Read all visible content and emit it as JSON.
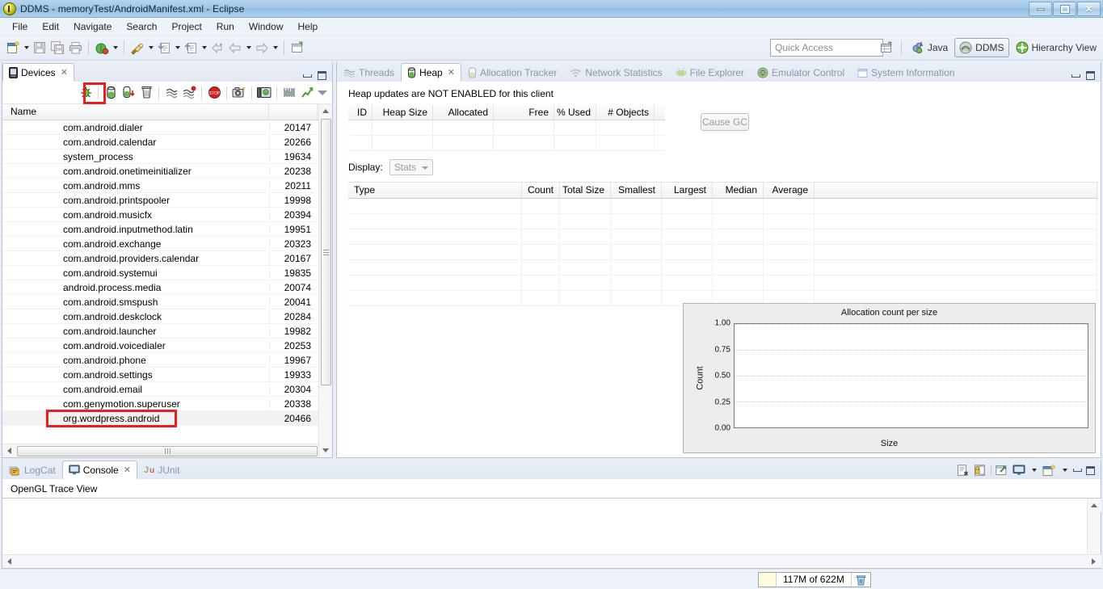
{
  "window": {
    "title": "DDMS - memoryTest/AndroidManifest.xml - Eclipse",
    "app_icon": "eclipse-icon",
    "minimize": "minimize-icon",
    "maximize": "restore-icon",
    "close": "close-icon"
  },
  "menu": {
    "items": [
      "File",
      "Edit",
      "Navigate",
      "Search",
      "Project",
      "Run",
      "Window",
      "Help"
    ]
  },
  "toolbar": {
    "icons": [
      "new-wizard-icon",
      "save-icon",
      "save-all-icon",
      "print-icon",
      "debug-icon",
      "run-icon",
      "external-tools-icon",
      "new-java-class-icon",
      "open-type-icon",
      "back-icon",
      "previous-icon",
      "forward-icon",
      "open-perspective-icon"
    ],
    "quick_access": {
      "placeholder": "Quick Access",
      "value": ""
    },
    "open_perspective_icon": "open-perspective-icon",
    "perspectives": [
      {
        "label": "Java",
        "icon": "java-perspective-icon",
        "active": false
      },
      {
        "label": "DDMS",
        "icon": "ddms-perspective-icon",
        "active": true
      },
      {
        "label": "Hierarchy View",
        "icon": "hierarchy-view-perspective-icon",
        "active": false
      }
    ]
  },
  "devices_view": {
    "tab_label": "Devices",
    "tab_icon": "device-icon",
    "tab_close": "close-icon",
    "minimize": "minimize-icon",
    "maximize": "maximize-icon",
    "toolbar_icons": [
      "debug-process-icon",
      "update-heap-icon",
      "dump-hprof-icon",
      "cause-gc-icon",
      "update-threads-icon",
      "start-method-profiling-icon",
      "stop-process-icon",
      "screen-capture-icon",
      "device-screenshot-icon",
      "systrace-icon",
      "opengl-trace-icon"
    ],
    "highlighted_toolbar_icon": "update-heap-icon",
    "view_menu_icon": "view-menu-icon",
    "columns": [
      "Name",
      ""
    ],
    "rows": [
      {
        "name": "com.android.dialer",
        "pid": "20147"
      },
      {
        "name": "com.android.calendar",
        "pid": "20266"
      },
      {
        "name": "system_process",
        "pid": "19634"
      },
      {
        "name": "com.android.onetimeinitializer",
        "pid": "20238"
      },
      {
        "name": "com.android.mms",
        "pid": "20211"
      },
      {
        "name": "com.android.printspooler",
        "pid": "19998"
      },
      {
        "name": "com.android.musicfx",
        "pid": "20394"
      },
      {
        "name": "com.android.inputmethod.latin",
        "pid": "19951"
      },
      {
        "name": "com.android.exchange",
        "pid": "20323"
      },
      {
        "name": "com.android.providers.calendar",
        "pid": "20167"
      },
      {
        "name": "com.android.systemui",
        "pid": "19835"
      },
      {
        "name": "android.process.media",
        "pid": "20074"
      },
      {
        "name": "com.android.smspush",
        "pid": "20041"
      },
      {
        "name": "com.android.deskclock",
        "pid": "20284"
      },
      {
        "name": "com.android.launcher",
        "pid": "19982"
      },
      {
        "name": "com.android.voicedialer",
        "pid": "20253"
      },
      {
        "name": "com.android.phone",
        "pid": "19967"
      },
      {
        "name": "com.android.settings",
        "pid": "19933"
      },
      {
        "name": "com.android.email",
        "pid": "20304"
      },
      {
        "name": "com.genymotion.superuser",
        "pid": "20338"
      },
      {
        "name": "org.wordpress.android",
        "pid": "20466"
      }
    ],
    "selected_row": "org.wordpress.android",
    "highlight_color": "#ee1c1c"
  },
  "heap_view": {
    "tabs": [
      {
        "label": "Threads",
        "icon": "threads-icon",
        "active": false
      },
      {
        "label": "Heap",
        "icon": "heap-icon",
        "active": true
      },
      {
        "label": "Allocation Tracker",
        "icon": "allocation-tracker-icon",
        "active": false
      },
      {
        "label": "Network Statistics",
        "icon": "network-statistics-icon",
        "active": false
      },
      {
        "label": "File Explorer",
        "icon": "file-explorer-icon",
        "active": false
      },
      {
        "label": "Emulator Control",
        "icon": "emulator-control-icon",
        "active": false
      },
      {
        "label": "System Information",
        "icon": "system-information-icon",
        "active": false
      }
    ],
    "active_tab_close": "close-icon",
    "minimize": "minimize-icon",
    "maximize": "maximize-icon",
    "message": "Heap updates are NOT ENABLED for this client",
    "summary_columns": [
      "ID",
      "Heap Size",
      "Allocated",
      "Free",
      "% Used",
      "# Objects"
    ],
    "summary_rows": [],
    "cause_gc_label": "Cause GC",
    "display_label": "Display:",
    "display_value": "Stats",
    "display_options": [
      "Stats"
    ],
    "type_columns": [
      "Type",
      "Count",
      "Total Size",
      "Smallest",
      "Largest",
      "Median",
      "Average"
    ],
    "type_rows": []
  },
  "chart_data": {
    "type": "bar",
    "title": "Allocation count per size",
    "xlabel": "Size",
    "ylabel": "Count",
    "categories": [],
    "values": [],
    "yticks": [
      "0.00",
      "0.25",
      "0.50",
      "0.75",
      "1.00"
    ],
    "ylim": [
      0,
      1
    ],
    "xticks": [],
    "grid": true,
    "legend": "none"
  },
  "console_view": {
    "tabs": [
      {
        "label": "LogCat",
        "icon": "logcat-icon",
        "active": false
      },
      {
        "label": "Console",
        "icon": "console-icon",
        "active": true
      },
      {
        "label": "JUnit",
        "icon": "junit-icon",
        "active": false
      }
    ],
    "active_tab_close": "close-icon",
    "toolbar_icons": [
      "clear-console-icon",
      "scroll-lock-icon",
      "pin-console-icon",
      "display-selected-console-icon",
      "display-selected-console-dropdown-icon",
      "open-console-icon",
      "open-console-dropdown-icon"
    ],
    "minimize": "minimize-icon",
    "maximize": "maximize-icon",
    "content": "OpenGL Trace View"
  },
  "status_bar": {
    "heap_text": "117M of 622M",
    "trash_icon": "trash-icon"
  }
}
